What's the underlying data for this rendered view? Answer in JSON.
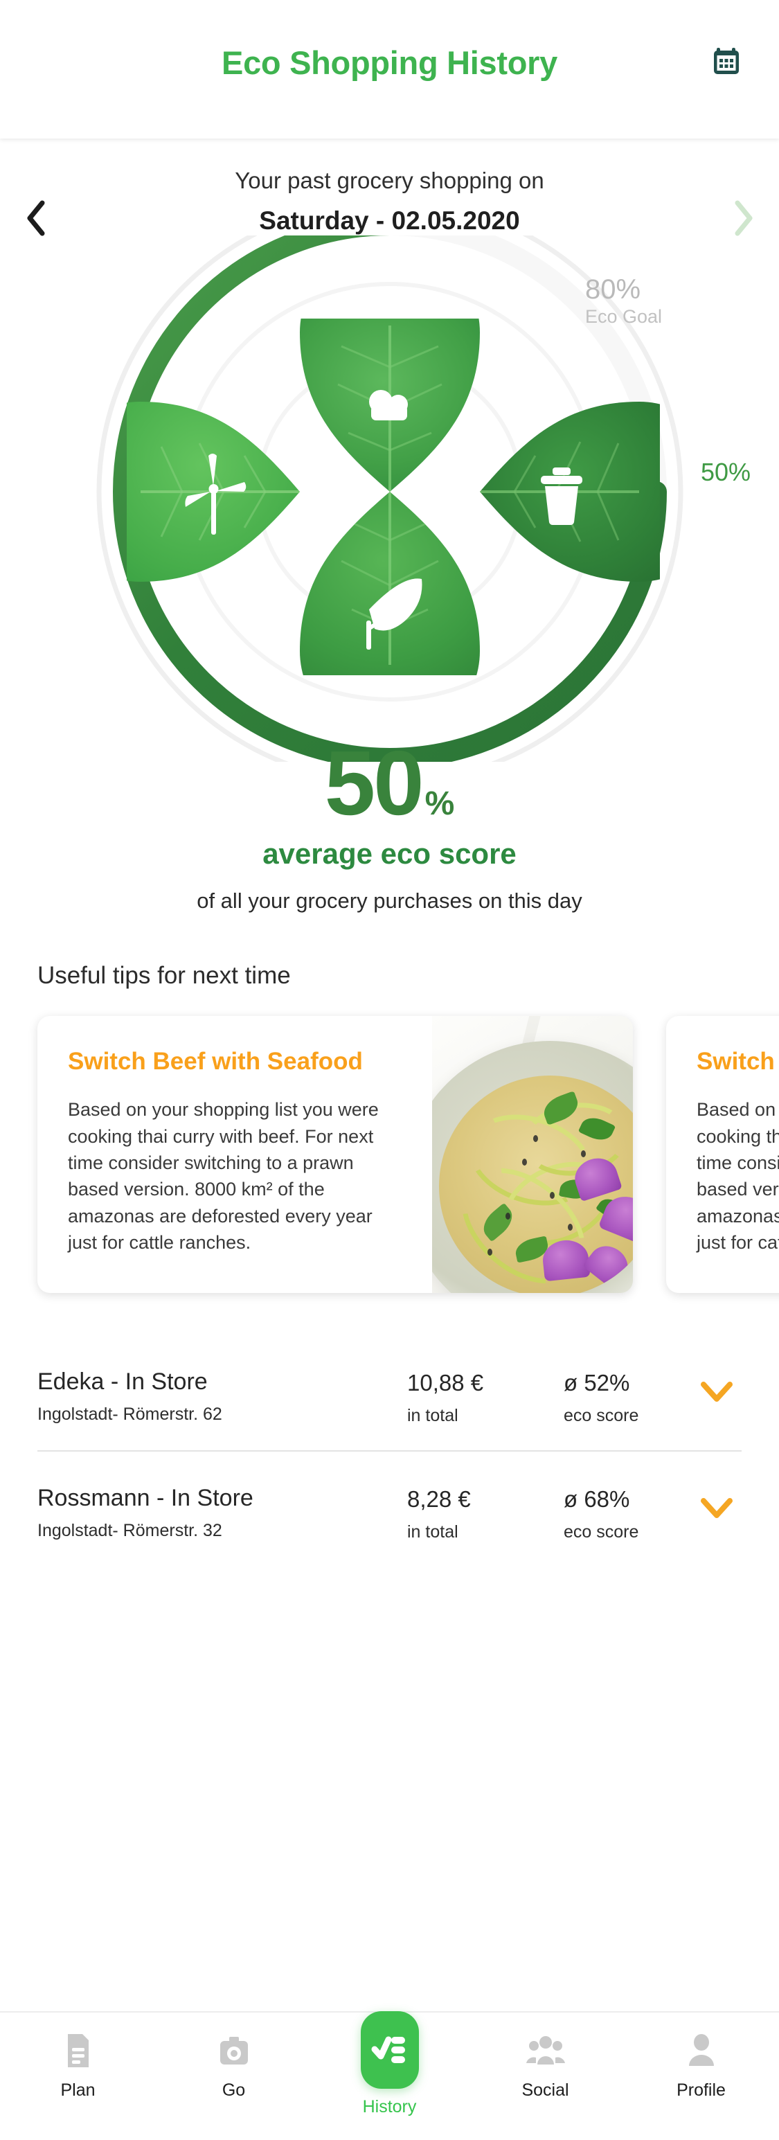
{
  "header": {
    "title": "Eco Shopping History",
    "title_color": "#3eb34f",
    "calendar_icon": "calendar-icon"
  },
  "date_nav": {
    "subtitle": "Your past grocery shopping on",
    "date": "Saturday - 02.05.2020",
    "prev_icon": "chevron-left-icon",
    "next_icon": "chevron-right-icon"
  },
  "gauge": {
    "goal_percent": "80%",
    "goal_label": "Eco Goal",
    "current_percent": "50%",
    "accent_color": "#3f9a44",
    "track_color": "#f1f1f1",
    "petals": [
      {
        "name": "cloud-icon",
        "position": "top"
      },
      {
        "name": "trash-icon",
        "position": "right"
      },
      {
        "name": "leaf-icon",
        "position": "bottom"
      },
      {
        "name": "wind-turbine-icon",
        "position": "left"
      }
    ]
  },
  "score": {
    "value": "50",
    "unit": "%",
    "label": "average eco score",
    "sub": "of all your grocery purchases on this day",
    "color": "#39833c"
  },
  "tips": {
    "heading": "Useful tips for next time",
    "cards": [
      {
        "title": "Switch Beef with Seafood",
        "body": "Based on your shopping list you were cooking thai curry with beef. For next time consider switching to a prawn based version. 8000 km² of the amazonas are deforested every year just for cattle ranches.",
        "title_color": "#f9a01b",
        "image": "thai-noodle-soup-photo"
      },
      {
        "title": "Switch Beef with Seafood",
        "body": "Based on your shopping list you were cooking thai curry with beef. For next time consider switching to a prawn based version. 8000 km² of the amazonas are deforested every year just for cattle ranches.",
        "title_color": "#f9a01b",
        "image": "thai-noodle-soup-photo"
      }
    ]
  },
  "stores": [
    {
      "name": "Edeka - In Store",
      "address": "Ingolstadt- Römerstr. 62",
      "total": "10,88 €",
      "total_sub": "in total",
      "score": "ø 52%",
      "score_sub": "eco score",
      "expand_icon": "chevron-down-icon"
    },
    {
      "name": "Rossmann - In Store",
      "address": "Ingolstadt- Römerstr. 32",
      "total": "8,28 €",
      "total_sub": "in total",
      "score": "ø 68%",
      "score_sub": "eco score",
      "expand_icon": "chevron-down-icon"
    }
  ],
  "bottom_nav": {
    "active_color": "#35c44c",
    "items": [
      {
        "label": "Plan",
        "icon": "document-icon",
        "active": false
      },
      {
        "label": "Go",
        "icon": "camera-icon",
        "active": false
      },
      {
        "label": "History",
        "icon": "checklist-icon",
        "active": true
      },
      {
        "label": "Social",
        "icon": "people-icon",
        "active": false
      },
      {
        "label": "Profile",
        "icon": "person-icon",
        "active": false
      }
    ]
  }
}
